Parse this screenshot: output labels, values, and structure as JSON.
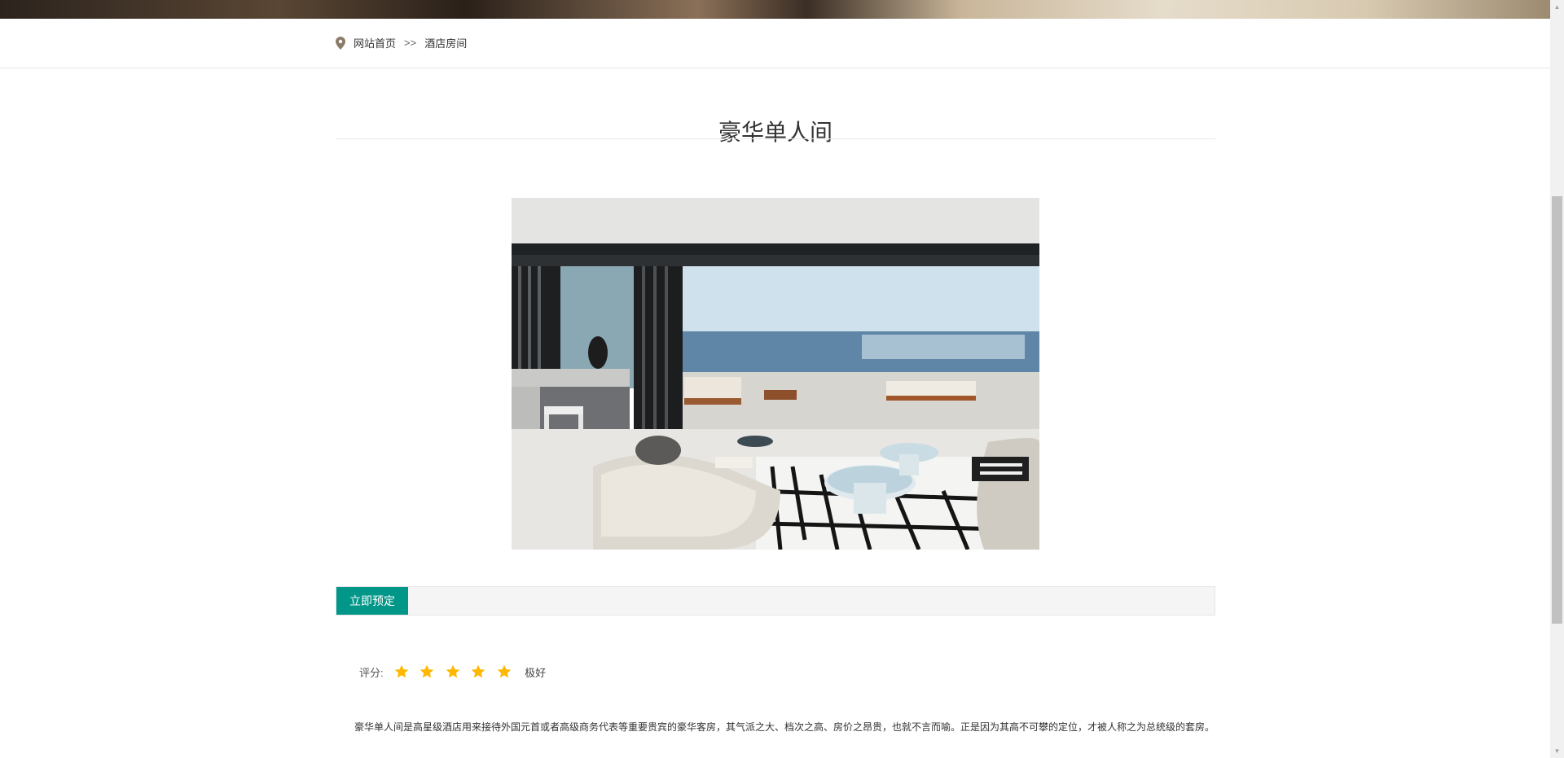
{
  "breadcrumb": {
    "icon": "location-pin-icon",
    "home": "网站首页",
    "separator": ">>",
    "current": "酒店房间"
  },
  "room": {
    "title": "豪华单人间",
    "photo_alt": "豪华单人间",
    "book_button": "立即预定",
    "rating_label": "评分:",
    "rating_value": 5,
    "rating_max": 5,
    "rating_text": "极好",
    "description": "豪华单人间是高星级酒店用来接待外国元首或者高级商务代表等重要贵宾的豪华客房，其气派之大、档次之高、房价之昂贵，也就不言而喻。正是因为其高不可攀的定位，才被人称之为总统级的套房。"
  },
  "colors": {
    "accent": "#009688",
    "star": "#FFB800",
    "pin": "#8d7b69"
  }
}
